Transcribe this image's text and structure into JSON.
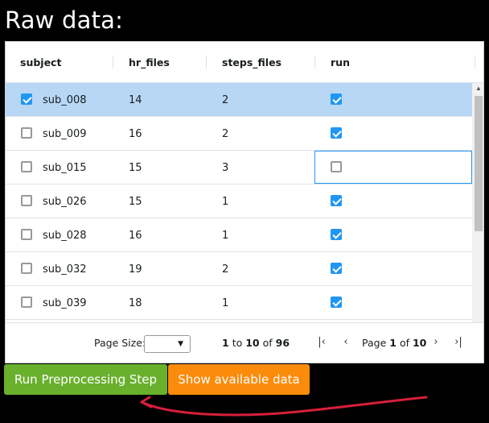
{
  "title": "Raw data:",
  "columns": [
    "subject",
    "hr_files",
    "steps_files",
    "run"
  ],
  "rows": [
    {
      "subject": "sub_008",
      "hr_files": "14",
      "steps_files": "2",
      "run": true,
      "selected": true
    },
    {
      "subject": "sub_009",
      "hr_files": "16",
      "steps_files": "2",
      "run": true,
      "selected": false
    },
    {
      "subject": "sub_015",
      "hr_files": "15",
      "steps_files": "3",
      "run": false,
      "selected": false
    },
    {
      "subject": "sub_026",
      "hr_files": "15",
      "steps_files": "1",
      "run": true,
      "selected": false
    },
    {
      "subject": "sub_028",
      "hr_files": "16",
      "steps_files": "1",
      "run": true,
      "selected": false
    },
    {
      "subject": "sub_032",
      "hr_files": "19",
      "steps_files": "2",
      "run": true,
      "selected": false
    },
    {
      "subject": "sub_039",
      "hr_files": "18",
      "steps_files": "1",
      "run": true,
      "selected": false
    }
  ],
  "pagination": {
    "page_size_label": "Page Size:",
    "page_size_value": "",
    "range_from": "1",
    "range_to_label": "to",
    "range_to": "10",
    "range_of_label": "of",
    "total": "96",
    "page_label": "Page",
    "page_current": "1",
    "page_of_label": "of",
    "page_total": "10",
    "icons": [
      "first-page-icon",
      "prev-page-icon",
      "next-page-icon",
      "last-page-icon"
    ]
  },
  "buttons": {
    "run_label": "Run Preprocessing Step",
    "show_label": "Show available data"
  },
  "colors": {
    "selected_row": "#b7d7f5",
    "checkbox_blue": "#2196f3",
    "run_button": "#69b02d",
    "show_button": "#fb8b0b",
    "annotation": "#d71f3a"
  }
}
